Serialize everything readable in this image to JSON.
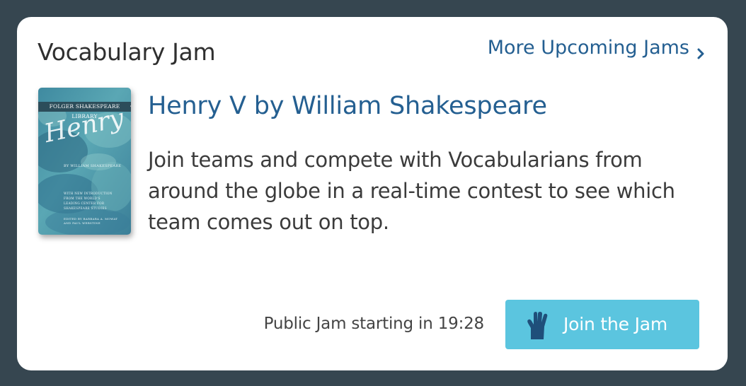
{
  "card": {
    "title": "Vocabulary Jam",
    "more_link": "More Upcoming Jams"
  },
  "book": {
    "series": "FOLGER SHAKESPEARE LIBRARY",
    "script_title": "Henry V",
    "author_line": "BY WILLIAM SHAKESPEARE",
    "blurb": "WITH NEW INTRODUCTION\nFROM THE WORLD'S\nLEADING CENTER FOR\nSHAKESPEARE STUDIES",
    "editors": "EDITED BY BARBARA A. MOWAT\nAND PAUL WERSTINE"
  },
  "jam": {
    "title": "Henry V by William Shakespeare",
    "description": "Join teams and compete with Vocabularians from around the globe in a real-time contest to see which team comes out on top."
  },
  "footer": {
    "status": "Public Jam starting in 19:28",
    "join_label": "Join the Jam"
  },
  "colors": {
    "page_bg": "#364650",
    "link": "#245f91",
    "button": "#5bc5df",
    "hand_icon": "#1f4f7a"
  },
  "icons": {
    "more_link": "chevron-right-icon",
    "join": "raised-hand-icon"
  }
}
